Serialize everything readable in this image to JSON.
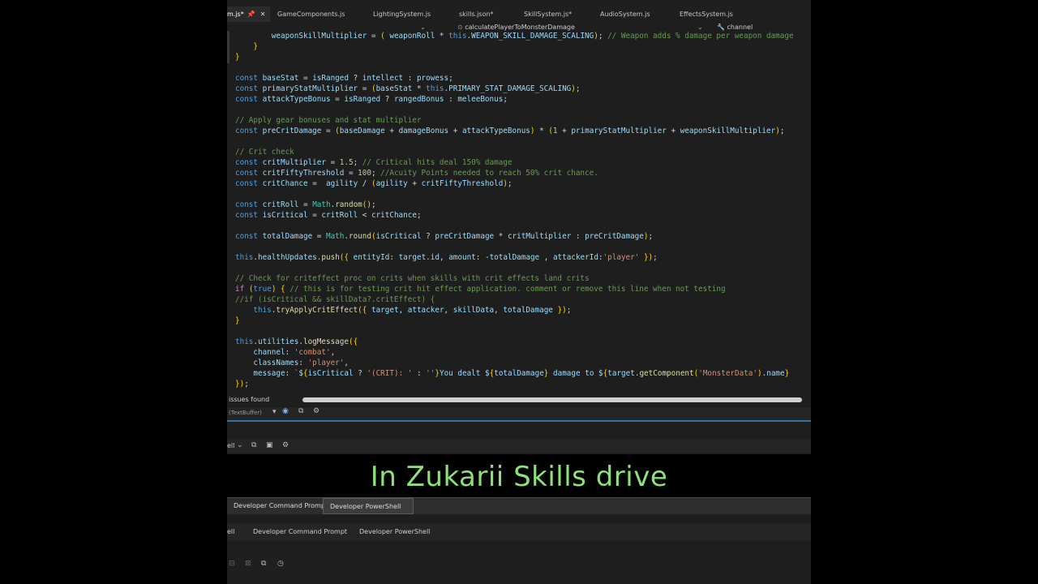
{
  "tabs": [
    {
      "label": "m.js*",
      "active": true
    },
    {
      "label": "GameComponents.js"
    },
    {
      "label": "LightingSystem.js"
    },
    {
      "label": "skills.json*"
    },
    {
      "label": "SkillSystem.js*"
    },
    {
      "label": "AudioSystem.js"
    },
    {
      "label": "EffectsSystem.js"
    }
  ],
  "nav": {
    "function": "calculatePlayerToMonsterDamage",
    "variable": "channel"
  },
  "status": {
    "issues": "issues found",
    "buffer": "TextBuffer"
  },
  "panel": {
    "left_label": "ell"
  },
  "caption": "In Zukarii Skills drive",
  "terminal": {
    "tab1": "Developer Command Prompt",
    "tab2": "Developer PowerShell",
    "row2_prefix": "ell",
    "row2_tab1": "Developer Command Prompt",
    "row2_tab2": "Developer PowerShell"
  },
  "code_lines": [
    "        weaponSkillMultiplier = ( weaponRoll * this.WEAPON_SKILL_DAMAGE_SCALING); // Weapon adds % damage per weapon damage",
    "    }",
    "}",
    "",
    "const baseStat = isRanged ? intellect : prowess;",
    "const primaryStatMultiplier = (baseStat * this.PRIMARY_STAT_DAMAGE_SCALING);",
    "const attackTypeBonus = isRanged ? rangedBonus : meleeBonus;",
    "",
    "// Apply gear bonuses and stat multiplier",
    "const preCritDamage = (baseDamage + damageBonus + attackTypeBonus) * (1 + primaryStatMultiplier + weaponSkillMultiplier);",
    "",
    "// Crit check",
    "const critMultiplier = 1.5; // Critical hits deal 150% damage",
    "const critFiftyThreshold = 100; //Acuity Points needed to reach 50% crit chance.",
    "const critChance =  agility / (agility + critFiftyThreshold);",
    "",
    "const critRoll = Math.random();",
    "const isCritical = critRoll < critChance;",
    "",
    "const totalDamage = Math.round(isCritical ? preCritDamage * critMultiplier : preCritDamage);",
    "",
    "this.healthUpdates.push({ entityId: target.id, amount: -totalDamage , attackerId:'player' });",
    "",
    "// Check for criteffect proc on crits when skills with crit effects land crits",
    "if (true) { // this is for testing crit hit effect application. comment or remove this line when not testing",
    "//if (isCritical && skillData?.critEffect) {",
    "    this.tryApplyCritEffect({ target, attacker, skillData, totalDamage });",
    "}",
    "",
    "this.utilities.logMessage({",
    "    channel: 'combat',",
    "    classNames: 'player',",
    "    message: `${isCritical ? '(CRIT): ' : ''}You dealt ${totalDamage} damage to ${target.getComponent('MonsterData').name}",
    "});"
  ]
}
